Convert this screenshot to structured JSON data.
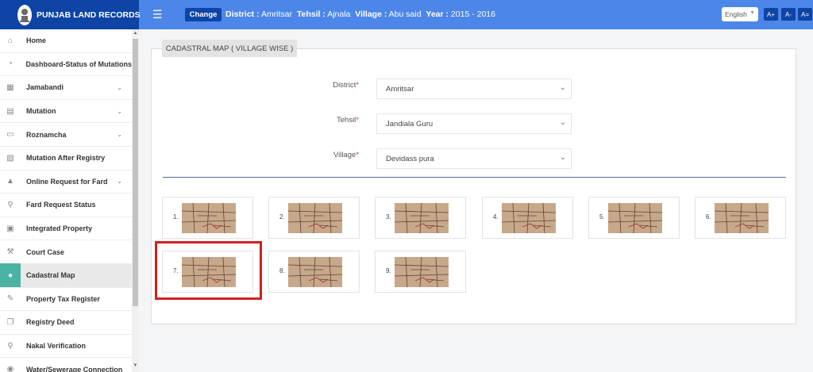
{
  "header": {
    "brand_title": "PUNJAB LAND RECORDS",
    "change_label": "Change",
    "district_label": "District :",
    "district_value": "Amritsar",
    "tehsil_label": "Tehsil :",
    "tehsil_value": "Ajnala",
    "village_label": "Village :",
    "village_value": "Abu said",
    "year_label": "Year :",
    "year_value": "2015 - 2016",
    "language": "English",
    "font_increase": "A+",
    "font_decrease": "A-",
    "font_reset": "A="
  },
  "sidebar": {
    "items": [
      {
        "label": "Home",
        "icon": "home-icon",
        "has_submenu": false
      },
      {
        "label": "Dashboard-Status of Mutations",
        "icon": "dashboard-icon",
        "has_submenu": false
      },
      {
        "label": "Jamabandi",
        "icon": "table-icon",
        "has_submenu": true
      },
      {
        "label": "Mutation",
        "icon": "file-icon",
        "has_submenu": true
      },
      {
        "label": "Roznamcha",
        "icon": "book-icon",
        "has_submenu": true
      },
      {
        "label": "Mutation After Registry",
        "icon": "briefcase-icon",
        "has_submenu": false
      },
      {
        "label": "Online Request for Fard",
        "icon": "fire-icon",
        "has_submenu": true
      },
      {
        "label": "Fard Request Status",
        "icon": "search-icon",
        "has_submenu": false
      },
      {
        "label": "Integrated Property",
        "icon": "bank-icon",
        "has_submenu": false
      },
      {
        "label": "Court Case",
        "icon": "gavel-icon",
        "has_submenu": false
      },
      {
        "label": "Cadastral Map",
        "icon": "map-marker-icon",
        "has_submenu": false,
        "active": true
      },
      {
        "label": "Property Tax Register",
        "icon": "edit-icon",
        "has_submenu": false
      },
      {
        "label": "Registry Deed",
        "icon": "copy-icon",
        "has_submenu": false
      },
      {
        "label": "Nakal Verification",
        "icon": "search-icon",
        "has_submenu": false
      },
      {
        "label": "Water/Sewerage Connection",
        "icon": "drop-icon",
        "has_submenu": false
      }
    ]
  },
  "main": {
    "panel_title": "CADASTRAL MAP ( VILLAGE WISE )",
    "district": {
      "label": "District",
      "value": "Amritsar"
    },
    "tehsil": {
      "label": "Tehsil",
      "value": "Jandiala Guru"
    },
    "village": {
      "label": "Village",
      "value": "Devidass pura"
    },
    "maps": [
      {
        "number": "1."
      },
      {
        "number": "2."
      },
      {
        "number": "3."
      },
      {
        "number": "4."
      },
      {
        "number": "5."
      },
      {
        "number": "6."
      },
      {
        "number": "7."
      },
      {
        "number": "8."
      },
      {
        "number": "9."
      }
    ],
    "highlighted_map": "7."
  },
  "colors": {
    "topbar": "#4c86e9",
    "brand": "#0d44a6",
    "active_icon_bg": "#4ab3a3",
    "highlight": "#d02020"
  }
}
